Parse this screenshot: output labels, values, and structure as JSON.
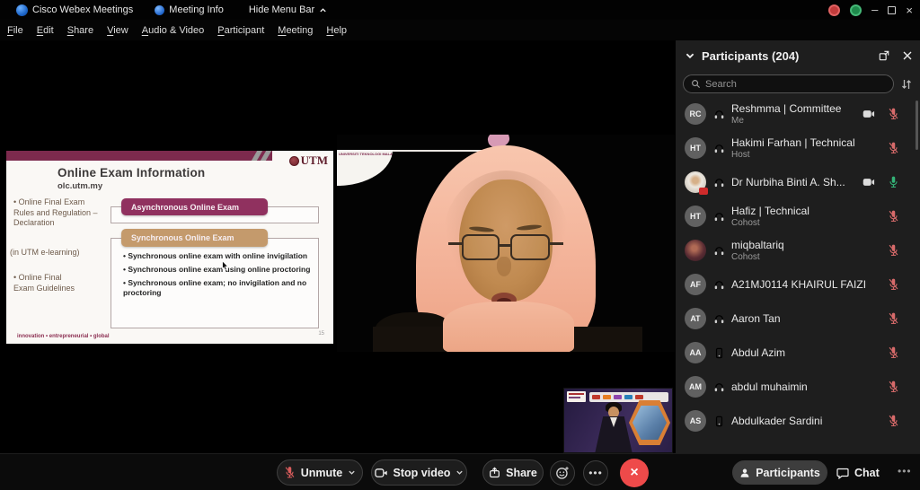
{
  "titlebar": {
    "app_name": "Cisco Webex Meetings",
    "meeting_info": "Meeting Info",
    "hide_menu_bar": "Hide Menu Bar"
  },
  "menubar": {
    "items": [
      "File",
      "Edit",
      "Share",
      "View",
      "Audio & Video",
      "Participant",
      "Meeting",
      "Help"
    ]
  },
  "slide": {
    "title": "Online Exam Information",
    "subtitle": "olc.utm.my",
    "logo_text": "UTM",
    "left_bullets": [
      "Online Final Exam Rules and Regulation – Declaration",
      "(in UTM e-learning)",
      "Online Final Exam Guidelines"
    ],
    "box_async_label": "Asynchronous Online Exam",
    "box_sync_label": "Synchronous Online Exam",
    "sync_bullets": [
      "Synchronous online exam with online invigilation",
      "Synchronous online exam using online proctoring",
      "Synchronous online exam; no invigilation and no proctoring"
    ],
    "footer": "innovation • entrepreneurial • global",
    "page_number": "15"
  },
  "speaker_video": {
    "overlay_text": "UNIVERSITI TEKNOLOGI MALAYSIA"
  },
  "participants_panel": {
    "title": "Participants (204)",
    "search_placeholder": "Search",
    "rows": [
      {
        "initials": "RC",
        "name": "Reshmma | Committee",
        "subtitle": "Me",
        "device": "headset",
        "camera": true,
        "mic": "muted"
      },
      {
        "initials": "HT",
        "name": "Hakimi Farhan | Technical",
        "subtitle": "Host",
        "device": "headset",
        "camera": false,
        "mic": "muted"
      },
      {
        "initials": "",
        "name": "Dr Nurbiha Binti A. Sh...",
        "subtitle": "",
        "device": "headset",
        "camera": true,
        "mic": "on",
        "avatar": "photo"
      },
      {
        "initials": "HT",
        "name": "Hafiz | Technical",
        "subtitle": "Cohost",
        "device": "headset",
        "camera": false,
        "mic": "muted"
      },
      {
        "initials": "",
        "name": "miqbaltariq",
        "subtitle": "Cohost",
        "device": "headset",
        "camera": false,
        "mic": "muted",
        "avatar": "photo"
      },
      {
        "initials": "AF",
        "name": "A21MJ0114 KHAIRUL FAIZI",
        "subtitle": "",
        "device": "headset",
        "camera": false,
        "mic": "muted"
      },
      {
        "initials": "AT",
        "name": "Aaron Tan",
        "subtitle": "",
        "device": "headset",
        "camera": false,
        "mic": "muted"
      },
      {
        "initials": "AA",
        "name": "Abdul Azim",
        "subtitle": "",
        "device": "phone",
        "camera": false,
        "mic": "muted"
      },
      {
        "initials": "AM",
        "name": "abdul muhaimin",
        "subtitle": "",
        "device": "headset",
        "camera": false,
        "mic": "muted"
      },
      {
        "initials": "AS",
        "name": "Abdulkader Sardini",
        "subtitle": "",
        "device": "phone",
        "camera": false,
        "mic": "muted"
      }
    ]
  },
  "toolbar": {
    "unmute_label": "Unmute",
    "stop_video_label": "Stop video",
    "share_label": "Share",
    "participants_label": "Participants",
    "chat_label": "Chat"
  },
  "colors": {
    "maroon_band": "#7d2a4d",
    "maroon_box": "#90315f",
    "tan_box": "#c49a6c",
    "mic_muted": "#d76a6a",
    "mic_on": "#33b377",
    "leave_red": "#ee4a4a",
    "webex_blue": "#1d66c9"
  }
}
